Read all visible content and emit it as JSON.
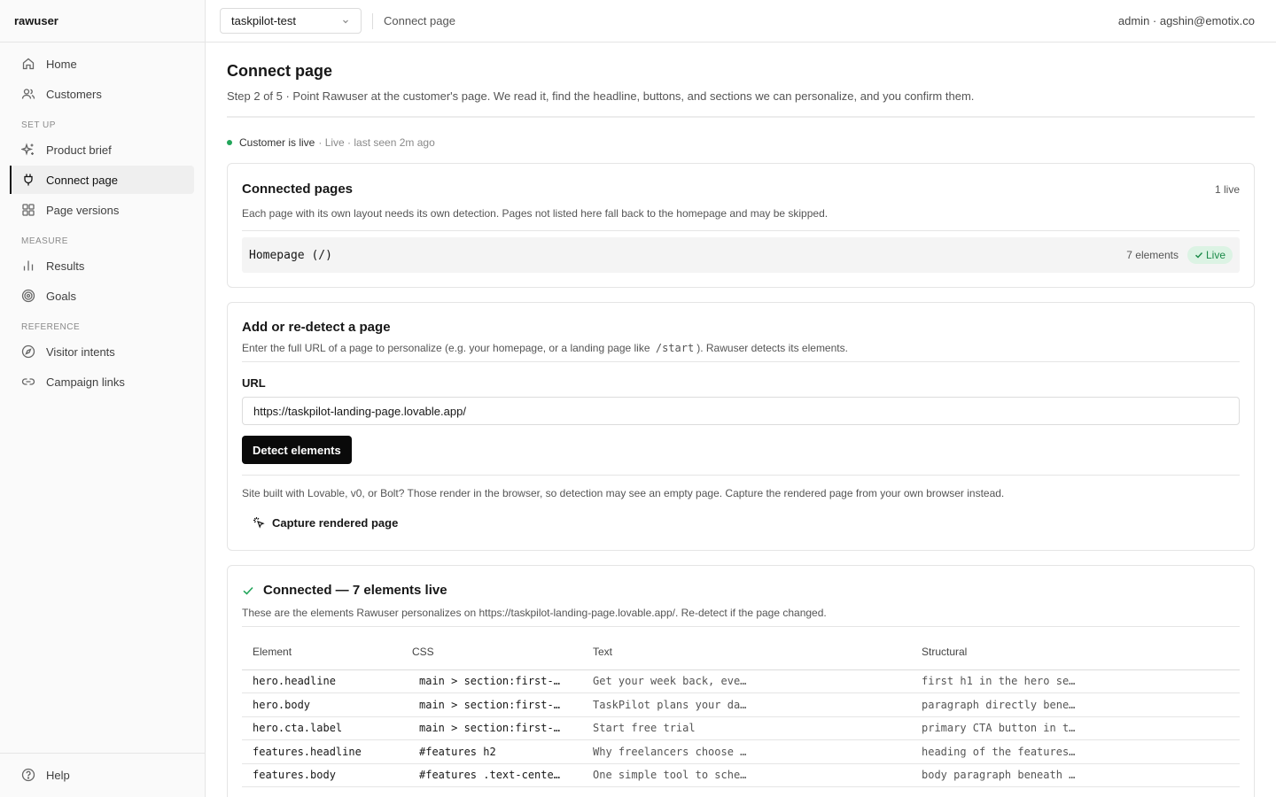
{
  "app": {
    "brand": "rawuser"
  },
  "sidebar": {
    "items": [
      {
        "label": "Home",
        "icon": "home-icon"
      },
      {
        "label": "Customers",
        "icon": "users-icon"
      }
    ],
    "groups": [
      {
        "label": "SET UP",
        "items": [
          {
            "label": "Product brief",
            "icon": "sparkles-icon"
          },
          {
            "label": "Connect page",
            "icon": "plug-icon",
            "active": true
          },
          {
            "label": "Page versions",
            "icon": "grid-icon"
          }
        ]
      },
      {
        "label": "MEASURE",
        "items": [
          {
            "label": "Results",
            "icon": "bar-chart-icon"
          },
          {
            "label": "Goals",
            "icon": "target-icon"
          }
        ]
      },
      {
        "label": "REFERENCE",
        "items": [
          {
            "label": "Visitor intents",
            "icon": "compass-icon"
          },
          {
            "label": "Campaign links",
            "icon": "link-icon"
          }
        ]
      }
    ],
    "footer": {
      "label": "Help",
      "icon": "help-circle-icon"
    }
  },
  "topbar": {
    "project": "taskpilot-test",
    "breadcrumb": "Connect page",
    "account": "admin · agshin@emotix.co"
  },
  "page": {
    "title": "Connect page",
    "subtitle": "Step 2 of 5 · Point Rawuser at the customer's page. We read it, find the headline, buttons, and sections we can personalize, and you confirm them.",
    "status": "Customer is live",
    "status_meta": "· Live · last seen 2m ago"
  },
  "connected_pages": {
    "title": "Connected pages",
    "count": "1 live",
    "description": "Each page with its own layout needs its own detection. Pages not listed here fall back to the homepage and may be skipped.",
    "rows": [
      {
        "name": "Homepage (/)",
        "elements": "7 elements",
        "status": "Live"
      }
    ]
  },
  "add_page": {
    "title": "Add or re-detect a page",
    "desc_before": "Enter the full URL of a page to personalize (e.g. your homepage, or a landing page like",
    "desc_code": "/start",
    "desc_after": "). Rawuser detects its elements.",
    "url_label": "URL",
    "url_value": "https://taskpilot-landing-page.lovable.app/",
    "detect_button": "Detect elements",
    "note": "Site built with Lovable, v0, or Bolt? Those render in the browser, so detection may see an empty page. Capture the rendered page from your own browser instead.",
    "capture_button": "Capture rendered page"
  },
  "connected": {
    "title": "Connected — 7 elements live",
    "description": "These are the elements Rawuser personalizes on https://taskpilot-landing-page.lovable.app/. Re-detect if the page changed.",
    "columns": [
      "Element",
      "CSS",
      "Text",
      "Structural"
    ],
    "rows": [
      {
        "element": "hero.headline",
        "css": "main > section:first-…",
        "text": "Get your week back, eve…",
        "structural": "first h1 in the hero se…"
      },
      {
        "element": "hero.body",
        "css": "main > section:first-…",
        "text": "TaskPilot plans your da…",
        "structural": "paragraph directly bene…"
      },
      {
        "element": "hero.cta.label",
        "css": "main > section:first-…",
        "text": "Start free trial",
        "structural": "primary CTA button in t…"
      },
      {
        "element": "features.headline",
        "css": "#features h2",
        "text": "Why freelancers choose …",
        "structural": "heading of the features…"
      },
      {
        "element": "features.body",
        "css": "#features .text-cente…",
        "text": "One simple tool to sche…",
        "structural": "body paragraph beneath …"
      }
    ]
  },
  "colors": {
    "accent": "#0a0a0a",
    "live": "#22a55a",
    "live_badge_bg": "#dcf3e4",
    "live_badge_text": "#1a8a48"
  }
}
